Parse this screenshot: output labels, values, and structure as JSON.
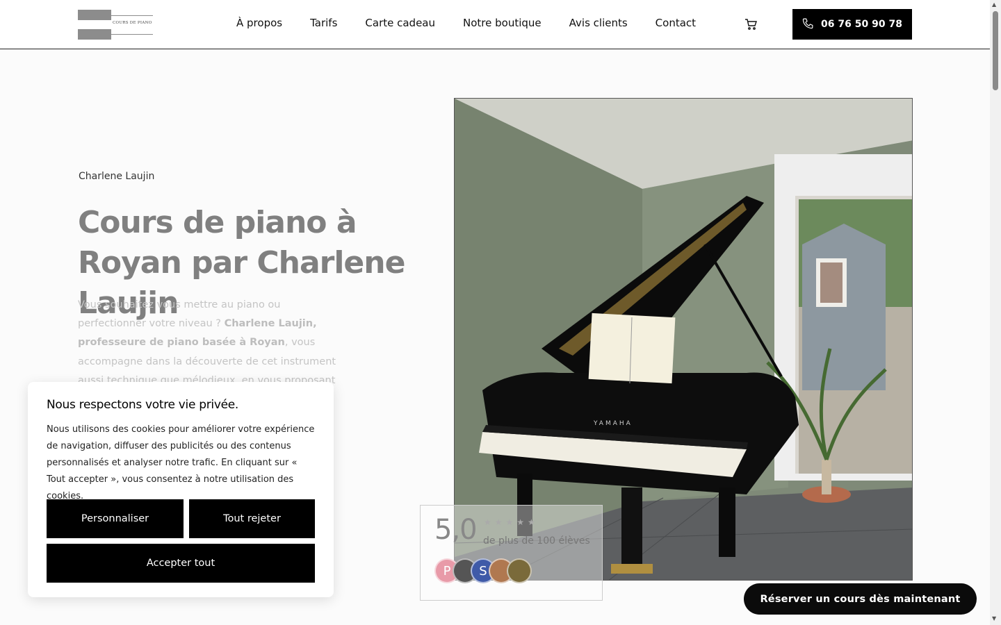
{
  "header": {
    "logo_text": "COURS DE PIANO",
    "nav": [
      {
        "label": "À propos"
      },
      {
        "label": "Tarifs"
      },
      {
        "label": "Carte cadeau"
      },
      {
        "label": "Notre boutique"
      },
      {
        "label": "Avis clients"
      },
      {
        "label": "Contact"
      }
    ],
    "cart_icon": "cart-icon",
    "phone": {
      "icon": "phone-icon",
      "label": "06 76 50 90 78"
    }
  },
  "hero": {
    "eyebrow": "Charlene  Laujin",
    "title": "Cours de piano à  Royan par Charlene  Laujin",
    "text_intro": "Vous souhaitez vous mettre au piano ou perfectionner votre niveau ? ",
    "text_bold": "Charlene  Laujin, professeure de piano basée à  Royan",
    "text_rest": ", vous accompagne dans la découverte de cet instrument aussi technique que mélodieux, en vous proposant des cours adaptés à votre niveau et"
  },
  "photo": {
    "alt": "grand piano YAMAHA",
    "brand": "YAMAHA"
  },
  "rating": {
    "score": "5,0",
    "stars": "★★★★★",
    "caption": "de plus de 100 élèves",
    "avatars": [
      {
        "letter": "P",
        "color": "#e89aa8"
      },
      {
        "letter": "",
        "color": "#555555"
      },
      {
        "letter": "S",
        "color": "#3f5aa8"
      },
      {
        "letter": "",
        "color": "#b07850"
      },
      {
        "letter": "",
        "color": "#7a6a3a"
      }
    ]
  },
  "cookie": {
    "title": "Nous respectons votre vie privée.",
    "text": "Nous utilisons des cookies pour améliorer votre expérience de navigation, diffuser des publicités ou des contenus personnalisés et analyser notre trafic.  En cliquant sur « Tout accepter », vous consentez à notre utilisation des cookies.",
    "customize": "Personnaliser",
    "reject": "Tout rejeter",
    "accept": "Accepter tout"
  },
  "cta": {
    "reserve": "Réserver un cours dès maintenant"
  },
  "colors": {
    "accent": "#000000",
    "title_gray": "#808080"
  }
}
